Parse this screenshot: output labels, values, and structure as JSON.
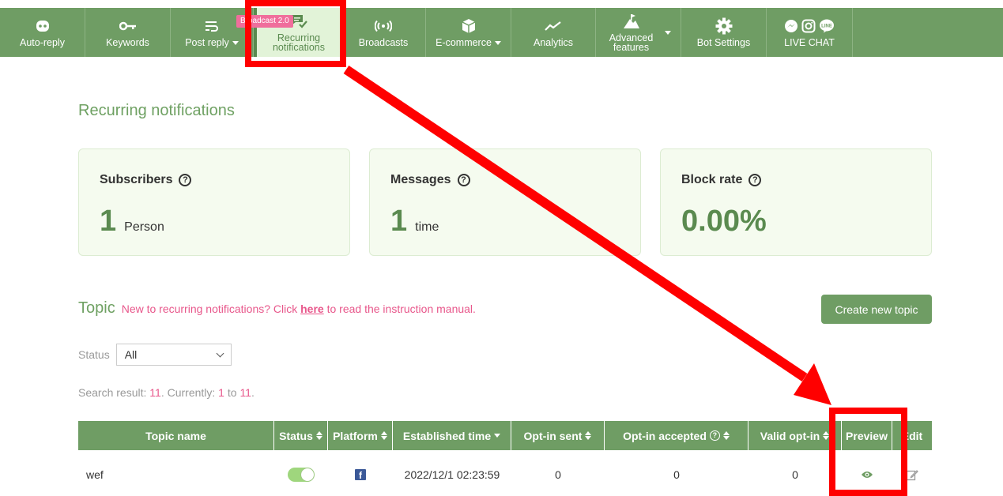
{
  "nav": {
    "items": [
      {
        "name": "nav-auto-reply",
        "label": "Auto-reply",
        "icon": "robot-icon",
        "dropdown": false
      },
      {
        "name": "nav-keywords",
        "label": "Keywords",
        "icon": "key-icon",
        "dropdown": false
      },
      {
        "name": "nav-post-reply",
        "label": "Post reply",
        "icon": "reply-lines-icon",
        "dropdown": true
      },
      {
        "name": "nav-recurring-notifications",
        "label": "Recurring notifications",
        "icon": "chat-check-icon",
        "dropdown": false,
        "active": true,
        "badge": "Broadcast 2.0"
      },
      {
        "name": "nav-broadcasts",
        "label": "Broadcasts",
        "icon": "broadcast-icon",
        "dropdown": false
      },
      {
        "name": "nav-ecommerce",
        "label": "E-commerce",
        "icon": "box-icon",
        "dropdown": true
      },
      {
        "name": "nav-analytics",
        "label": "Analytics",
        "icon": "trend-icon",
        "dropdown": false
      },
      {
        "name": "nav-advanced-features",
        "label": "Advanced features",
        "icon": "mountain-flag-icon",
        "dropdown": true
      },
      {
        "name": "nav-bot-settings",
        "label": "Bot Settings",
        "icon": "gear-icon",
        "dropdown": false
      },
      {
        "name": "nav-live-chat",
        "label": "LIVE CHAT",
        "icon": "messenger-instagram-line-icons",
        "dropdown": false
      }
    ]
  },
  "page": {
    "title": "Recurring notifications"
  },
  "cards": {
    "subscribers": {
      "label": "Subscribers",
      "value": "1",
      "unit": "Person"
    },
    "messages": {
      "label": "Messages",
      "value": "1",
      "unit": "time"
    },
    "block_rate": {
      "label": "Block rate",
      "value": "0.00%"
    }
  },
  "topic": {
    "title": "Topic",
    "note_prefix": "New to recurring notifications? Click ",
    "note_link": "here",
    "note_suffix": " to read the instruction manual.",
    "create_button": "Create new topic"
  },
  "filter": {
    "label": "Status",
    "value": "All"
  },
  "search": {
    "prefix": "Search result: ",
    "total": "11",
    "middle": ". Currently: ",
    "from": "1",
    "to_word": " to ",
    "to": "11",
    "end": "."
  },
  "table": {
    "headers": {
      "topic_name": "Topic name",
      "status": "Status",
      "platform": "Platform",
      "established_time": "Established time",
      "optin_sent": "Opt-in sent",
      "optin_accepted": "Opt-in accepted",
      "valid_optin": "Valid opt-in",
      "preview": "Preview",
      "edit": "Edit"
    },
    "rows": [
      {
        "topic_name": "wef",
        "status_on": true,
        "platform": "f",
        "established_time": "2022/12/1 02:23:59",
        "optin_sent": "0",
        "optin_accepted": "0",
        "valid_optin": "0"
      }
    ]
  },
  "colors": {
    "brand_green": "#6f9d64",
    "accent_pink": "#e8578b",
    "annotation_red": "#ff0000"
  }
}
